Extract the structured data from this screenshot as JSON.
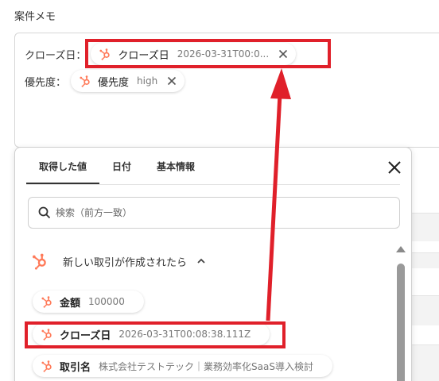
{
  "field_title": "案件メモ",
  "memo": {
    "row1_label": "クローズ日：",
    "row1_chip": {
      "name": "クローズ日",
      "value": "2026-03-31T00:0..."
    },
    "row2_label": "優先度：",
    "row2_chip": {
      "name": "優先度",
      "value": "high"
    }
  },
  "popover": {
    "tabs": [
      "取得した値",
      "日付",
      "基本情報"
    ],
    "active_tab": 0,
    "search_placeholder": "検索（前方一致）",
    "section_title": "新しい取引が作成されたら",
    "outputs": [
      {
        "name": "金額",
        "value": "100000"
      },
      {
        "name": "クローズ日",
        "value": "2026-03-31T00:08:38.111Z"
      },
      {
        "name": "取引名",
        "value": "株式会社テストテック｜業務効率化SaaS導入検討"
      }
    ]
  },
  "colors": {
    "accent_red": "#e0202a",
    "hubspot_orange": "#ff7a59"
  }
}
